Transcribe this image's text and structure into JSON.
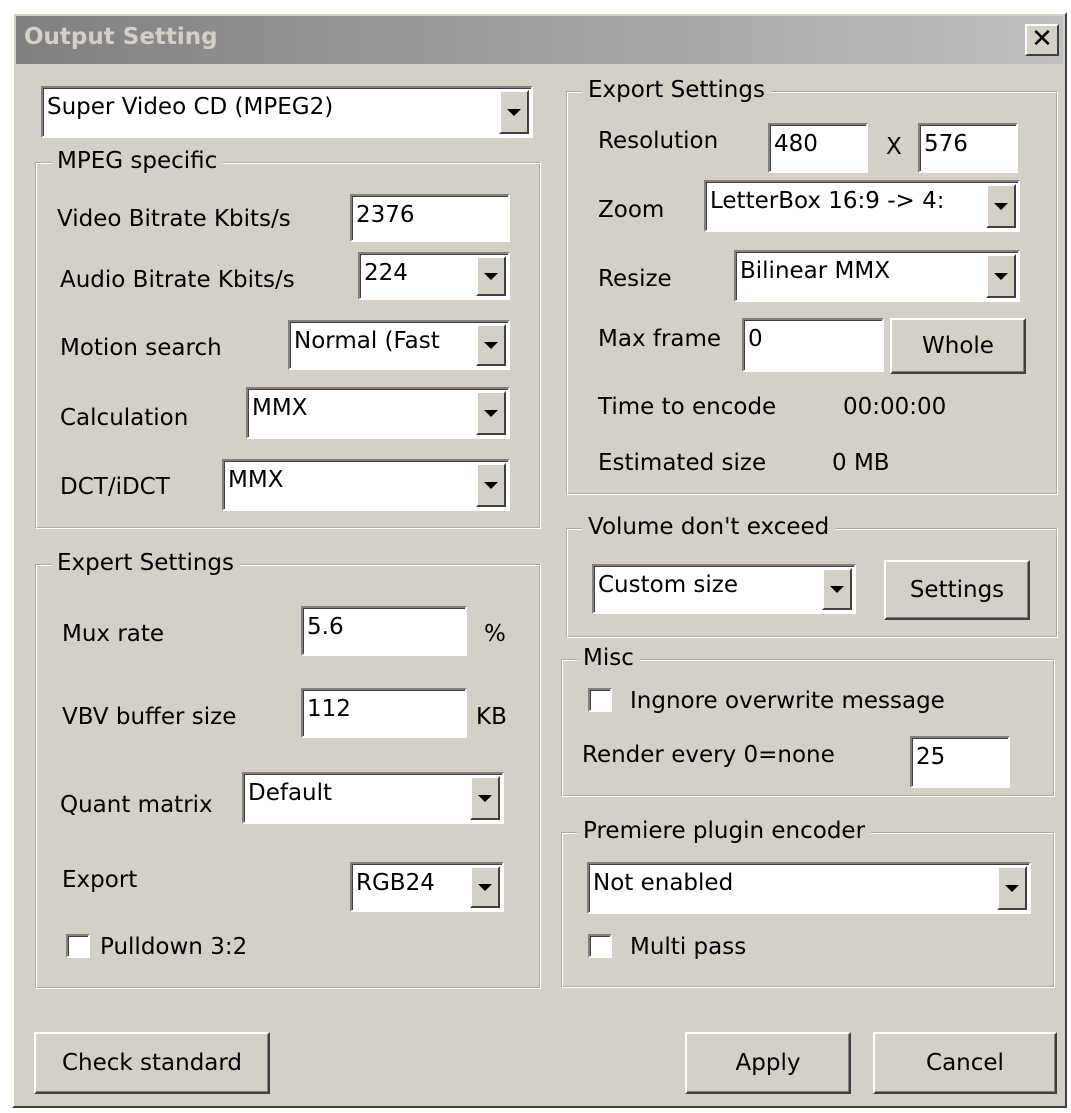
{
  "window": {
    "title": "Output Setting",
    "close_label": "✕"
  },
  "format_combo": {
    "value": "Super Video CD (MPEG2)"
  },
  "mpeg": {
    "legend": "MPEG specific",
    "video_bitrate_label": "Video Bitrate Kbits/s",
    "video_bitrate_value": "2376",
    "audio_bitrate_label": "Audio Bitrate Kbits/s",
    "audio_bitrate_value": "224",
    "motion_label": "Motion search",
    "motion_value": "Normal (Fast",
    "calc_label": "Calculation",
    "calc_value": "MMX",
    "dct_label": "DCT/iDCT",
    "dct_value": "MMX"
  },
  "expert": {
    "legend": "Expert Settings",
    "mux_label": "Mux rate",
    "mux_value": "5.6",
    "mux_unit": "%",
    "vbv_label": "VBV buffer size",
    "vbv_value": "112",
    "vbv_unit": "KB",
    "quant_label": "Quant matrix",
    "quant_value": "Default",
    "export_label": "Export",
    "export_value": "RGB24",
    "pulldown_label": "Pulldown 3:2",
    "pulldown_checked": false
  },
  "export": {
    "legend": "Export Settings",
    "resolution_label": "Resolution",
    "res_w": "480",
    "res_x": "X",
    "res_h": "576",
    "zoom_label": "Zoom",
    "zoom_value": "LetterBox 16:9 -> 4:",
    "resize_label": "Resize",
    "resize_value": "Bilinear MMX",
    "maxframe_label": "Max frame",
    "maxframe_value": "0",
    "whole_button": "Whole",
    "time_label": "Time to encode",
    "time_value": "00:00:00",
    "size_label": "Estimated size",
    "size_value": "0 MB"
  },
  "volume": {
    "legend": "Volume don't exceed",
    "value": "Custom size",
    "settings_button": "Settings"
  },
  "misc": {
    "legend": "Misc",
    "ignore_label": "Ingnore overwrite message",
    "ignore_checked": false,
    "render_label": "Render every 0=none",
    "render_value": "25"
  },
  "premiere": {
    "legend": "Premiere plugin encoder",
    "value": "Not enabled",
    "multipass_label": "Multi pass",
    "multipass_checked": false
  },
  "footer": {
    "check_button": "Check standard",
    "apply_button": "Apply",
    "cancel_button": "Cancel"
  }
}
